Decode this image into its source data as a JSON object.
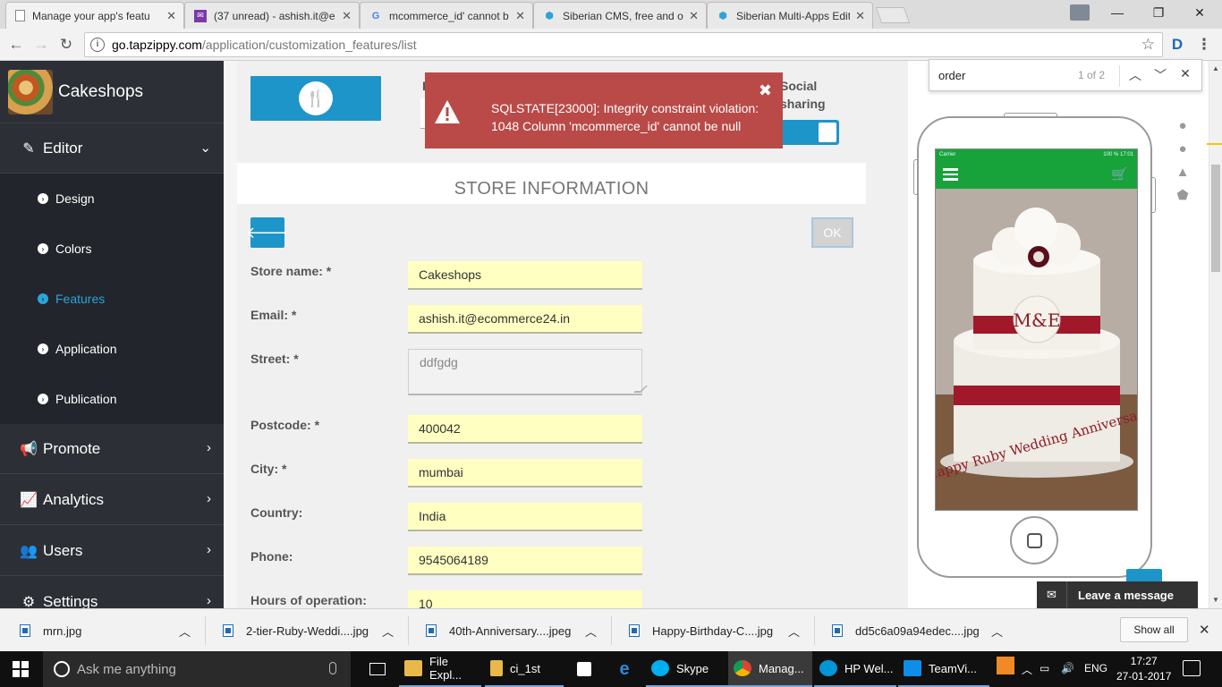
{
  "browser": {
    "tabs": [
      {
        "title": "Manage your app's featu",
        "active": true
      },
      {
        "title": "(37 unread) - ashish.it@e",
        "active": false
      },
      {
        "title": "mcommerce_id' cannot b",
        "active": false
      },
      {
        "title": "Siberian CMS, free and o",
        "active": false
      },
      {
        "title": "Siberian Multi-Apps Editi",
        "active": false
      }
    ],
    "url_host": "go.tapzippy.com",
    "url_path": "/application/customization_features/list"
  },
  "find_bar": {
    "query": "order",
    "count": "1 of 2"
  },
  "sidebar": {
    "app_name": "Cakeshops",
    "menu": [
      {
        "label": "Editor",
        "expanded": true
      },
      {
        "label": "Promote"
      },
      {
        "label": "Analytics"
      },
      {
        "label": "Users"
      },
      {
        "label": "Settings"
      }
    ],
    "submenu": [
      {
        "label": "Design"
      },
      {
        "label": "Colors"
      },
      {
        "label": "Features",
        "active": true
      },
      {
        "label": "Application"
      },
      {
        "label": "Publication"
      }
    ]
  },
  "main": {
    "partial_label": "F",
    "social_sharing": "Social\nsharing",
    "section_title": "STORE INFORMATION",
    "ok_label": "OK",
    "fields": [
      {
        "label": "Store name: *",
        "value": "Cakeshops"
      },
      {
        "label": "Email: *",
        "value": "ashish.it@ecommerce24.in"
      },
      {
        "label": "Street: *",
        "value": "ddfgdg"
      },
      {
        "label": "Postcode: *",
        "value": "400042"
      },
      {
        "label": "City: *",
        "value": "mumbai"
      },
      {
        "label": "Country:",
        "value": "India"
      },
      {
        "label": "Phone:",
        "value": "9545064189"
      },
      {
        "label": "Hours of operation:",
        "value": "10"
      }
    ]
  },
  "alert": {
    "message": "SQLSTATE[23000]: Integrity constraint violation: 1048 Column 'mcommerce_id' cannot be null",
    "color": "#b94a48"
  },
  "preview": {
    "status_left": "Carrier",
    "status_right": "100 %  17:01",
    "cake_text": "Happy Ruby Wedding Anniversary",
    "monogram": "M&E",
    "accent": "#18a33a"
  },
  "chat_widget": {
    "label": "Leave a message"
  },
  "downloads": {
    "items": [
      "mrn.jpg",
      "2-tier-Ruby-Weddi....jpg",
      "40th-Anniversary....jpeg",
      "Happy-Birthday-C....jpg",
      "dd5c6a09a94edec....jpg"
    ],
    "show_all": "Show all"
  },
  "taskbar": {
    "search_placeholder": "Ask me anything",
    "apps": [
      {
        "label": "File Expl..."
      },
      {
        "label": "ci_1st"
      },
      {
        "label": ""
      },
      {
        "label": ""
      },
      {
        "label": "Skype"
      },
      {
        "label": "Manag..."
      },
      {
        "label": "HP Wel..."
      },
      {
        "label": "TeamVi..."
      }
    ],
    "lang": "ENG",
    "time": "17:27",
    "date": "27-01-2017"
  }
}
